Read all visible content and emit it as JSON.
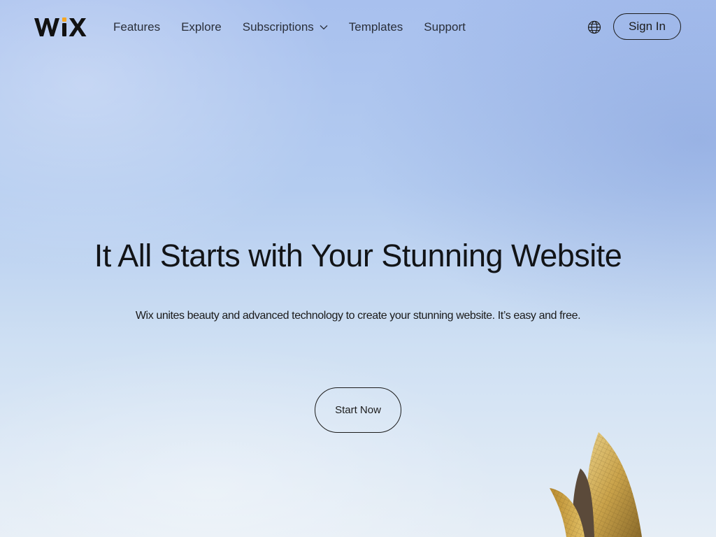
{
  "brand": {
    "logo_text": "WIX",
    "accent_color": "#f5a623"
  },
  "nav": {
    "items": [
      {
        "label": "Features"
      },
      {
        "label": "Explore"
      },
      {
        "label": "Subscriptions",
        "has_dropdown": true
      },
      {
        "label": "Templates"
      },
      {
        "label": "Support"
      }
    ]
  },
  "header": {
    "language_icon": "globe-icon",
    "sign_in_label": "Sign In"
  },
  "hero": {
    "title": "It All Starts with Your Stunning Website",
    "subtitle": "Wix unites beauty and advanced technology to create your stunning website. It’s easy and free.",
    "cta_label": "Start Now"
  },
  "colors": {
    "text": "#1a1a1a",
    "sky_top": "#a8c0ee",
    "sky_bottom": "#e6eef6",
    "building_gold": "#c9a24a"
  }
}
